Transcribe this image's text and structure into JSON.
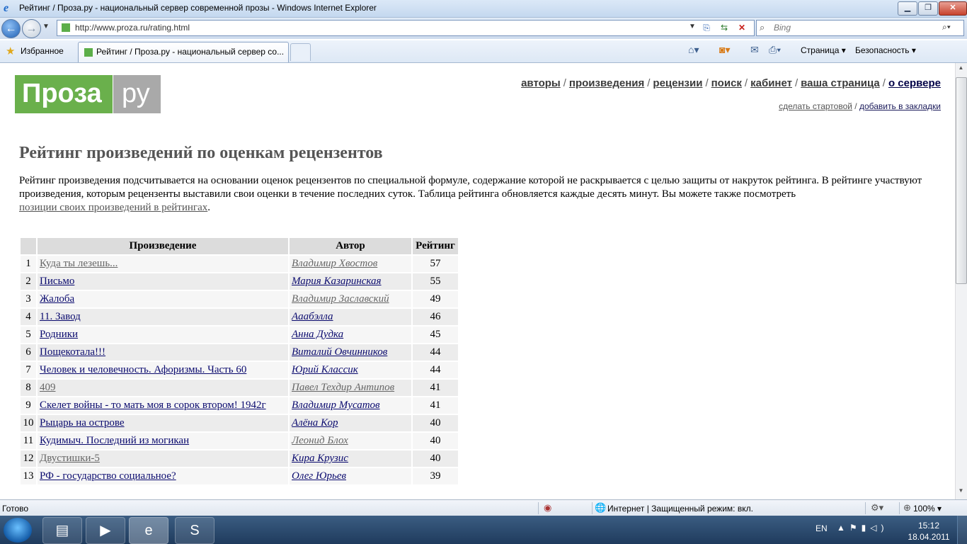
{
  "window": {
    "title": "Рейтинг / Проза.ру - национальный сервер современной прозы - Windows Internet Explorer",
    "min": "▁",
    "max": "❐",
    "close": "✕"
  },
  "nav": {
    "url": "http://www.proza.ru/rating.html",
    "search_placeholder": "Bing",
    "back_icon": "←",
    "forward_icon": "→"
  },
  "favbar": {
    "favorites_label": "Избранное",
    "tab_title": "Рейтинг / Проза.ру - национальный сервер со...",
    "page_menu": "Страница ▾",
    "safety_menu": "Безопасность ▾"
  },
  "site": {
    "logo_left": "Проза",
    "logo_right": "ру",
    "nav": [
      "авторы",
      "произведения",
      "рецензии",
      "поиск",
      "кабинет",
      "ваша страница",
      "о сервере"
    ],
    "subnav": [
      "сделать стартовой",
      "добавить в закладки"
    ],
    "heading": "Рейтинг произведений по оценкам рецензентов",
    "intro": "Рейтинг произведения подсчитывается на основании оценок рецензентов по специальной формуле, содержание которой не раскрывается с целью защиты от накруток рейтинга. В рейтинге участвуют произведения, которым рецензенты выставили свои оценки в течение последних суток. Таблица рейтинга обновляется каждые десять минут. Вы можете также посмотреть",
    "intro_link": "позиции своих произведений в рейтингах",
    "intro_end": "."
  },
  "table": {
    "headers": [
      "",
      "Произведение",
      "Автор",
      "Рейтинг"
    ],
    "rows": [
      {
        "n": "1",
        "work": "Куда ты лезешь...",
        "author": "Владимир Хвостов",
        "rating": "57",
        "work_visited": true,
        "author_visited": true
      },
      {
        "n": "2",
        "work": "Письмо",
        "author": "Мария Казаринская",
        "rating": "55",
        "work_visited": false,
        "author_visited": false
      },
      {
        "n": "3",
        "work": "Жалоба",
        "author": "Владимир Заславский",
        "rating": "49",
        "work_visited": false,
        "author_visited": true
      },
      {
        "n": "4",
        "work": "11. Завод",
        "author": "Аaабэлла",
        "rating": "46",
        "work_visited": false,
        "author_visited": false
      },
      {
        "n": "5",
        "work": "Родники",
        "author": "Анна Дудка",
        "rating": "45",
        "work_visited": false,
        "author_visited": false
      },
      {
        "n": "6",
        "work": "Пощекотала!!!",
        "author": "Виталий Овчинников",
        "rating": "44",
        "work_visited": false,
        "author_visited": false
      },
      {
        "n": "7",
        "work": "Человек и человечность. Афоризмы. Часть 60",
        "author": "Юрий Классик",
        "rating": "44",
        "work_visited": false,
        "author_visited": false
      },
      {
        "n": "8",
        "work": "409",
        "author": "Павел Техдир Антипов",
        "rating": "41",
        "work_visited": true,
        "author_visited": true
      },
      {
        "n": "9",
        "work": "Скелет войны - то мать моя в сорок втором! 1942г",
        "author": "Владимир Мусатов",
        "rating": "41",
        "work_visited": false,
        "author_visited": false
      },
      {
        "n": "10",
        "work": "Рыцарь на острове",
        "author": "Алёна Кор",
        "rating": "40",
        "work_visited": false,
        "author_visited": false
      },
      {
        "n": "11",
        "work": "Кудимыч. Последний из могикан",
        "author": "Леонид Блох",
        "rating": "40",
        "work_visited": false,
        "author_visited": true
      },
      {
        "n": "12",
        "work": "Двустишки-5",
        "author": "Кира Крузис",
        "rating": "40",
        "work_visited": true,
        "author_visited": false
      },
      {
        "n": "13",
        "work": "РФ - государство социальное?",
        "author": "Олег Юрьев",
        "rating": "39",
        "work_visited": false,
        "author_visited": false
      }
    ]
  },
  "status": {
    "text": "Готово",
    "zone": "Интернет | Защищенный режим: вкл.",
    "zoom": "100% ▾"
  },
  "taskbar": {
    "lang": "EN",
    "time": "15:12",
    "date": "18.04.2011"
  },
  "colors": {
    "logo_green": "#6ab04c",
    "logo_gray": "#a9a9a9",
    "visited_link": "#666666",
    "unvisited_link": "#0a0a6e"
  }
}
